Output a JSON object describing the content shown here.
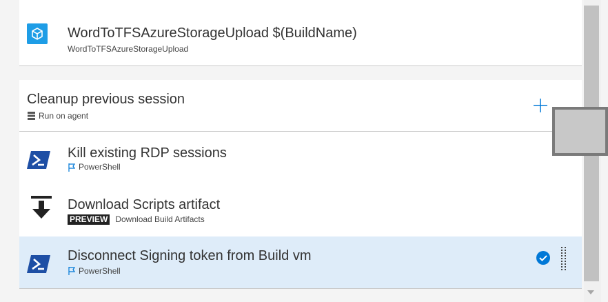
{
  "tasks_top": {
    "title": "WordToTFSAzureStorageUpload $(BuildName)",
    "subtitle": "WordToTFSAzureStorageUpload",
    "icon": "package-icon"
  },
  "phase": {
    "title": "Cleanup previous session",
    "subtitle": "Run on agent",
    "add_icon": "plus-icon",
    "server_icon": "server-icon"
  },
  "tasks": [
    {
      "title": "Kill existing RDP sessions",
      "subtitle": "PowerShell",
      "icon": "powershell-icon",
      "flag_icon": "flag-icon"
    },
    {
      "title": "Download Scripts artifact",
      "badge": "PREVIEW",
      "subtitle": "Download Build Artifacts",
      "icon": "download-arrow-icon"
    },
    {
      "title": "Disconnect Signing token from Build vm",
      "subtitle": "PowerShell",
      "icon": "powershell-icon",
      "flag_icon": "flag-icon",
      "selected": true
    }
  ],
  "colors": {
    "accent": "#0078d7",
    "selected_row": "#deecf9",
    "powershell": "#1e4fa5",
    "azure_icon_bg": "#1e9de6"
  }
}
